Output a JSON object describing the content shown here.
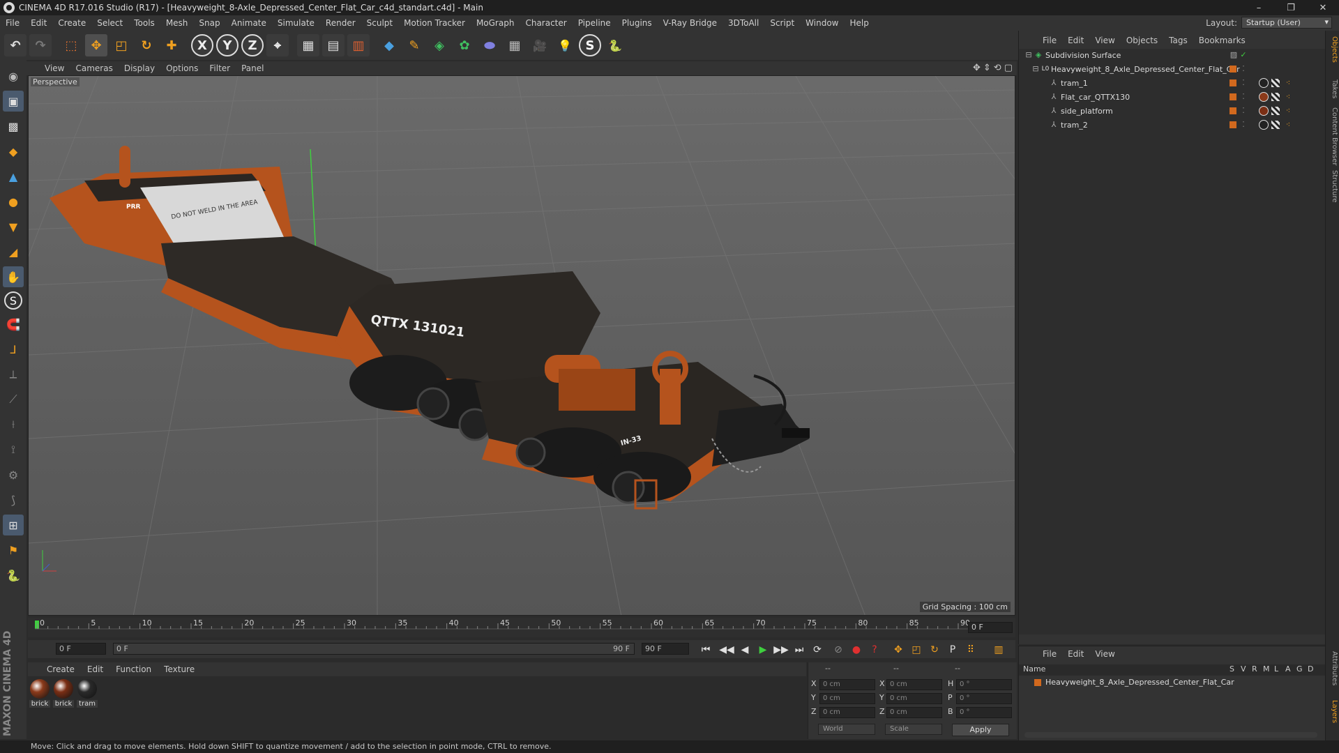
{
  "window": {
    "title": "CINEMA 4D R17.016 Studio (R17) - [Heavyweight_8-Axle_Depressed_Center_Flat_Car_c4d_standart.c4d] - Main",
    "controls": [
      "–",
      "❐",
      "✕"
    ]
  },
  "menu": [
    "File",
    "Edit",
    "Create",
    "Select",
    "Tools",
    "Mesh",
    "Snap",
    "Animate",
    "Simulate",
    "Render",
    "Sculpt",
    "Motion Tracker",
    "MoGraph",
    "Character",
    "Pipeline",
    "Plugins",
    "V-Ray Bridge",
    "3DToAll",
    "Script",
    "Window",
    "Help"
  ],
  "layout": {
    "label": "Layout:",
    "value": "Startup (User)"
  },
  "toolbar": {
    "undo": "↶",
    "redo": "↷",
    "select": "⬚",
    "move": "✥",
    "scale": "◰",
    "rotate": "↻",
    "place": "✚",
    "x": "X",
    "y": "Y",
    "z": "Z",
    "coord": "⌖",
    "render_view": "▦",
    "render_pic": "▤",
    "render_settings": "▥",
    "cube": "◆",
    "pen": "✎",
    "subdiv": "◈",
    "array": "✿",
    "deform": "⬬",
    "floor": "▦",
    "camera": "🎥",
    "light": "💡",
    "python_s": "S",
    "python": "🐍"
  },
  "left_tools": [
    "◉",
    "▣",
    "▩",
    "◆",
    "▲",
    "●",
    "▼",
    "◢",
    "✋",
    "S",
    "🧲",
    "⅃",
    "⟂",
    "⟋",
    "⟊",
    "⟟",
    "⚙",
    "⟆",
    "⊞",
    "⚑",
    "🐍"
  ],
  "viewport": {
    "menu": [
      "View",
      "Cameras",
      "Display",
      "Options",
      "Filter",
      "Panel"
    ],
    "nav_icons": [
      "✥",
      "⇕",
      "⟲",
      "▢"
    ],
    "label": "Perspective",
    "grid_spacing": "Grid Spacing : 100 cm",
    "decals": [
      "DO NOT WELD IN THE AREA",
      "QTTX 131021",
      "PRR",
      "IN-33"
    ]
  },
  "timeline": {
    "ticks": [
      "0",
      "5",
      "10",
      "15",
      "20",
      "25",
      "30",
      "35",
      "40",
      "45",
      "50",
      "55",
      "60",
      "65",
      "70",
      "75",
      "80",
      "85",
      "90"
    ],
    "current_frame": "0 F"
  },
  "playback": {
    "start": "0 F",
    "range_start": "0 F",
    "range_end": "90 F",
    "end": "90 F",
    "buttons": [
      "⏮",
      "◀◀",
      "◀",
      "▶",
      "▶▶",
      "⏭",
      "⟳"
    ],
    "right_buttons": [
      "⊘",
      "●",
      "?",
      "✥",
      "◰",
      "↻",
      "P",
      "⠿",
      "▥"
    ]
  },
  "materials": {
    "menu": [
      "Create",
      "Edit",
      "Function",
      "Texture"
    ],
    "items": [
      {
        "name": "brick",
        "color": "#8b3a1a"
      },
      {
        "name": "brick",
        "color": "#7a2e14"
      },
      {
        "name": "tram",
        "color": "#2a2a2a"
      }
    ]
  },
  "coordinates": {
    "header": [
      "--",
      "--",
      "--"
    ],
    "rows": [
      {
        "axis": "X",
        "pos": "0 cm",
        "axis2": "X",
        "size": "0 cm",
        "axis3": "H",
        "rot": "0 °"
      },
      {
        "axis": "Y",
        "pos": "0 cm",
        "axis2": "Y",
        "size": "0 cm",
        "axis3": "P",
        "rot": "0 °"
      },
      {
        "axis": "Z",
        "pos": "0 cm",
        "axis2": "Z",
        "size": "0 cm",
        "axis3": "B",
        "rot": "0 °"
      }
    ],
    "mode": "World",
    "transform": "Scale",
    "apply": "Apply"
  },
  "maxon": "MAXON CINEMA 4D",
  "status": "Move: Click and drag to move elements. Hold down SHIFT to quantize movement / add to the selection in point mode, CTRL to remove.",
  "objects": {
    "menu": [
      "File",
      "Edit",
      "View",
      "Objects",
      "Tags",
      "Bookmarks"
    ],
    "tree": [
      {
        "name": "Subdivision Surface",
        "indent": 0,
        "icon": "◈"
      },
      {
        "name": "Heavyweight_8_Axle_Depressed_Center_Flat_Car",
        "indent": 1,
        "icon": "L0"
      },
      {
        "name": "tram_1",
        "indent": 2,
        "icon": "⅄"
      },
      {
        "name": "Flat_car_QTTX130",
        "indent": 2,
        "icon": "⅄"
      },
      {
        "name": "side_platform",
        "indent": 2,
        "icon": "⅄"
      },
      {
        "name": "tram_2",
        "indent": 2,
        "icon": "⅄"
      }
    ]
  },
  "right_tabs": [
    "Objects",
    "Takes",
    "Content Browser",
    "Structure",
    "Attributes",
    "Layers"
  ],
  "layers": {
    "menu": [
      "File",
      "Edit",
      "View"
    ],
    "columns": [
      "Name",
      "S",
      "V",
      "R",
      "M",
      "L",
      "A",
      "G",
      "D"
    ],
    "row": "Heavyweight_8_Axle_Depressed_Center_Flat_Car"
  },
  "colors": {
    "accent": "#d2691e",
    "viewport_bg": "#5c5c5c",
    "selected_tool": "#4a5a6e"
  }
}
